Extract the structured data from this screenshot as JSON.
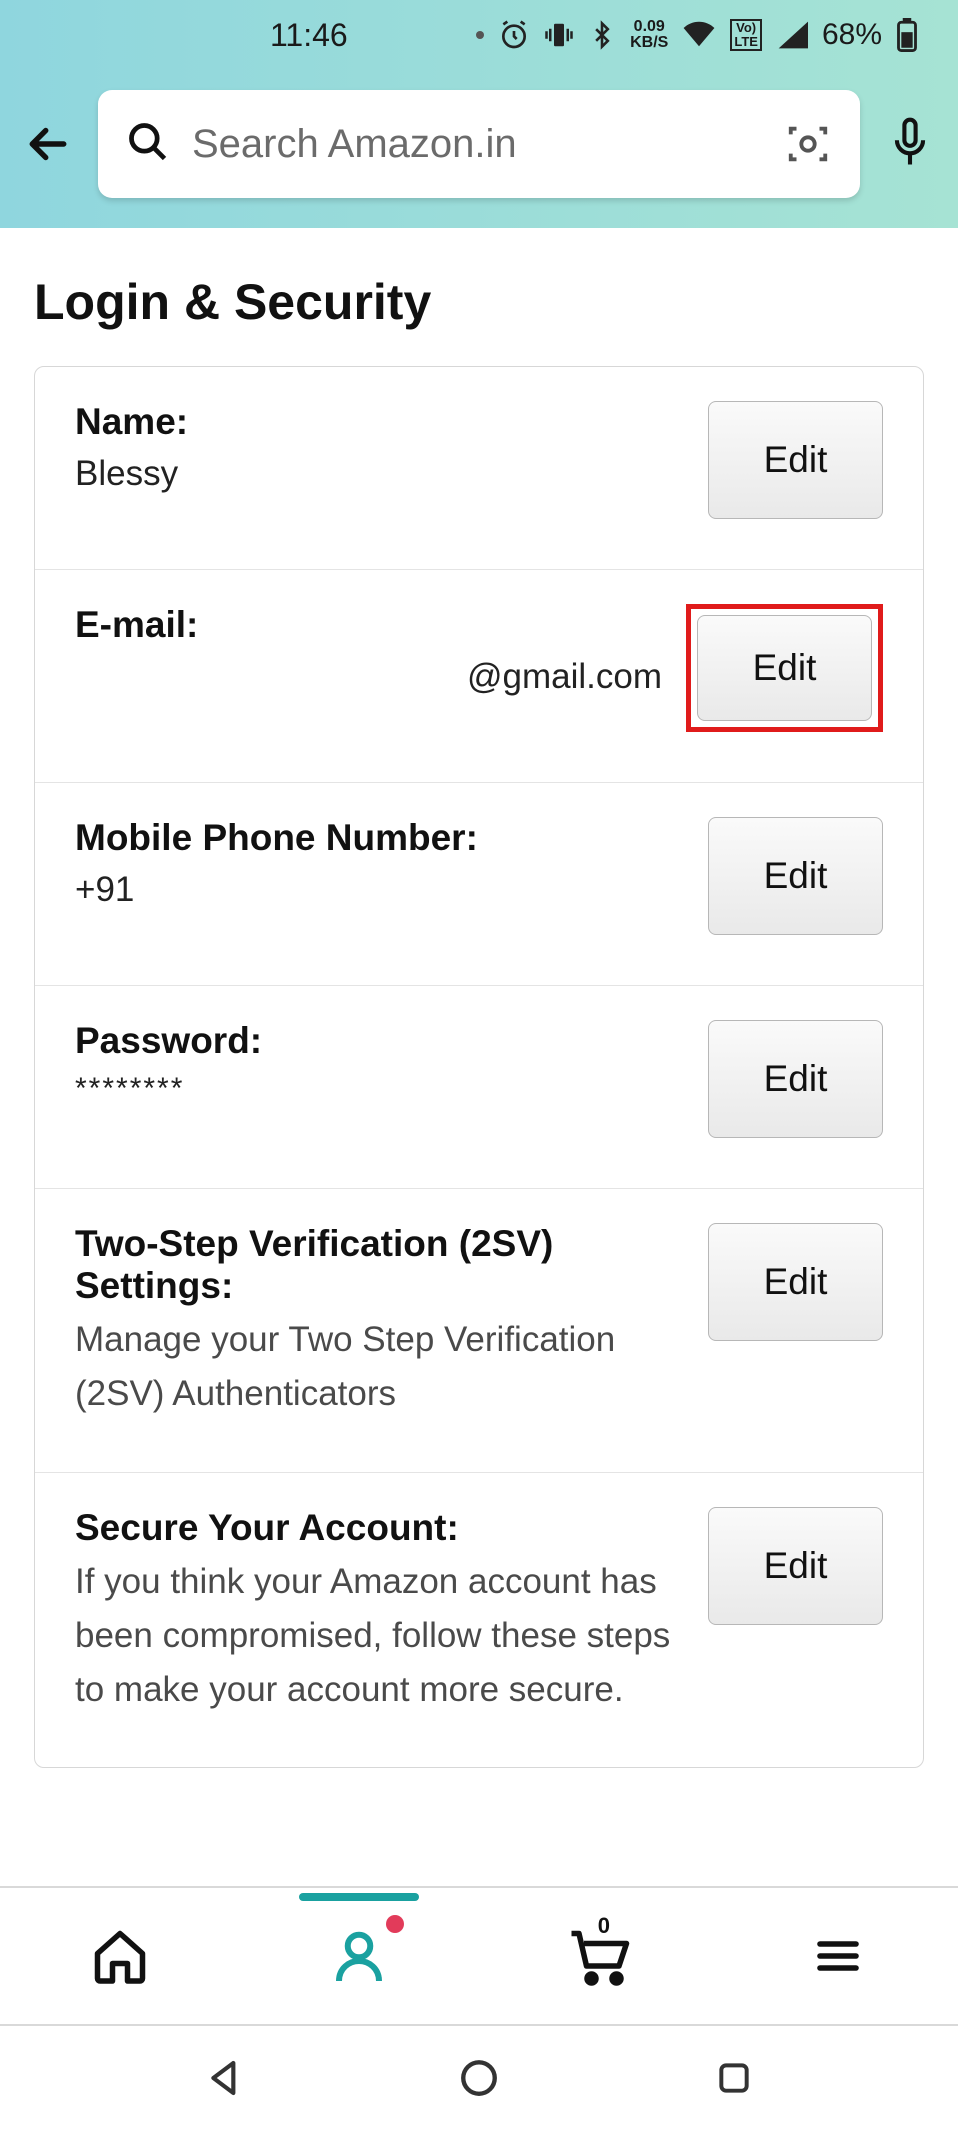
{
  "status": {
    "time": "11:46",
    "data_rate_top": "0.09",
    "data_rate_bottom": "KB/S",
    "lte_top": "Vo)",
    "lte_bottom": "LTE",
    "battery_pct": "68%"
  },
  "search": {
    "placeholder": "Search Amazon.in"
  },
  "page_title": "Login & Security",
  "rows": {
    "name": {
      "label": "Name:",
      "value": "Blessy",
      "edit": "Edit"
    },
    "email": {
      "label": "E-mail:",
      "value": "@gmail.com",
      "edit": "Edit"
    },
    "phone": {
      "label": "Mobile Phone Number:",
      "value": "+91",
      "edit": "Edit"
    },
    "password": {
      "label": "Password:",
      "value": "********",
      "edit": "Edit"
    },
    "twosv": {
      "label": "Two-Step Verification (2SV) Settings:",
      "desc": "Manage your Two Step Verification (2SV) Authenticators",
      "edit": "Edit"
    },
    "secure": {
      "label": "Secure Your Account:",
      "desc": "If you think your Amazon account has been compromised, follow these steps to make your account more secure.",
      "edit": "Edit"
    }
  },
  "cart_count": "0"
}
